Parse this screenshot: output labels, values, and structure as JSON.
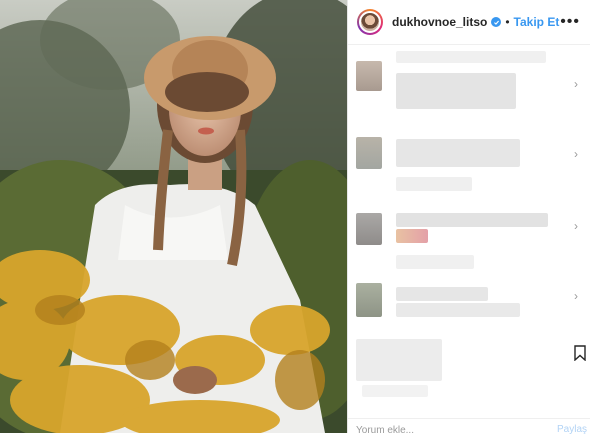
{
  "post": {
    "username": "dukhovnoe_litso",
    "separator": "•",
    "follow_label": "Takip Et",
    "more_label": "•••",
    "comment_placeholder": "Yorum ekle...",
    "share_label": "Paylaş"
  },
  "icons": {
    "verified": "verified-badge-icon",
    "more": "more-options-icon",
    "bookmark": "bookmark-icon",
    "chevron": "chevron-right-icon"
  },
  "colors": {
    "accent": "#3897f0",
    "text": "#262626",
    "border": "#efefef"
  }
}
